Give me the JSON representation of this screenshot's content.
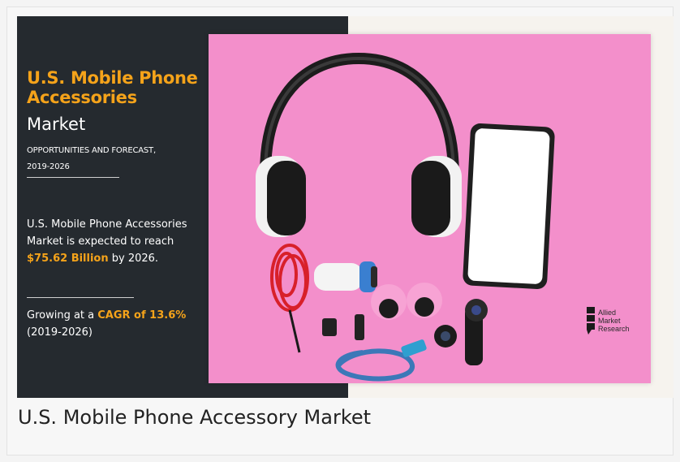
{
  "infographic": {
    "title_line1": "U.S. Mobile Phone",
    "title_line2": "Accessories",
    "title_line3": "Market",
    "subtitle_line1": "OPPORTUNITIES AND FORECAST,",
    "subtitle_line2": "2019-2026",
    "body_part1": "U.S. Mobile Phone Accessories Market is expected to reach",
    "body_value": "$75.62 Billion",
    "body_part2": " by 2026.",
    "growth_part1": "Growing at a ",
    "growth_value": "CAGR of 13.6%",
    "growth_part2": "(2019-2026)",
    "logo_line1": "Allied",
    "logo_line2": "Market",
    "logo_line3": "Research"
  },
  "caption": "U.S. Mobile Phone Accessory Market",
  "colors": {
    "accent": "#f5a31a",
    "panel": "#252a2f",
    "photo_background": "#f38fcb"
  },
  "icons": [
    "headphones-icon",
    "smartphone-icon",
    "car-charger-icon",
    "usb-cable-icon",
    "phone-lens-icon",
    "allied-market-research-logo"
  ]
}
